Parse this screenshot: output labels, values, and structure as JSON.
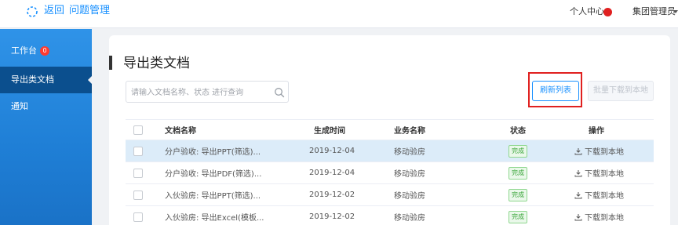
{
  "header": {
    "back_label": "返回",
    "app_title": "问题管理",
    "user_center": "个人中心",
    "role": "集团管理员"
  },
  "sidebar": {
    "items": [
      {
        "label": "工作台",
        "badge": "0"
      },
      {
        "label": "导出类文档"
      },
      {
        "label": "通知"
      }
    ]
  },
  "main": {
    "title": "导出类文档",
    "search": {
      "placeholder": "请输入文档名称、状态 进行查询",
      "value": ""
    },
    "refresh_label": "刷新列表",
    "batch_download_label": "批量下载到本地"
  },
  "table": {
    "columns": [
      "文档名称",
      "生成时间",
      "业务名称",
      "状态",
      "操作"
    ],
    "rows": [
      {
        "name": "分户验收: 导出PPT(筛选)...",
        "time": "2019-12-04",
        "business": "移动验房",
        "status": "完成",
        "action": "下载到本地"
      },
      {
        "name": "分户验收: 导出PDF(筛选)...",
        "time": "2019-12-04",
        "business": "移动验房",
        "status": "完成",
        "action": "下载到本地"
      },
      {
        "name": "入伙验房: 导出PPT(筛选)...",
        "time": "2019-12-02",
        "business": "移动验房",
        "status": "完成",
        "action": "下载到本地"
      },
      {
        "name": "入伙验房: 导出Excel(模板...",
        "time": "2019-12-02",
        "business": "移动验房",
        "status": "完成",
        "action": "下载到本地"
      }
    ]
  },
  "colors": {
    "accent": "#1890ff",
    "sidebar_active": "#0b4f8e",
    "highlight": "#e0201f",
    "status_done": "#3aa53a"
  }
}
